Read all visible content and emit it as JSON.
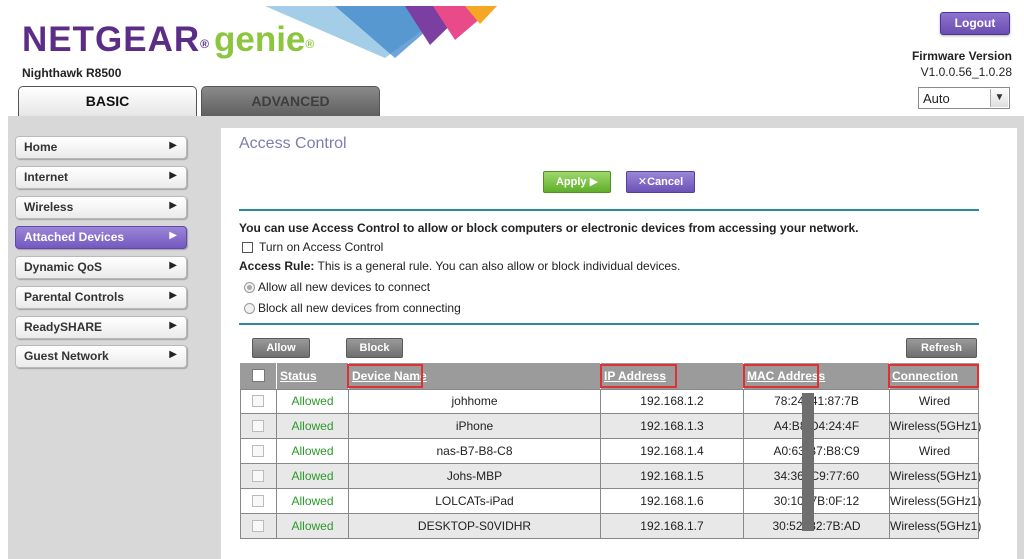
{
  "header": {
    "brand": "NETGEAR",
    "product": "genie",
    "model": "Nighthawk R8500",
    "logout_label": "Logout",
    "firmware_label": "Firmware Version",
    "firmware_version": "V1.0.0.56_1.0.28",
    "language_select": "Auto"
  },
  "tabs": [
    {
      "label": "BASIC",
      "active": true
    },
    {
      "label": "ADVANCED",
      "active": false
    }
  ],
  "sidebar": {
    "items": [
      {
        "label": "Home",
        "active": false
      },
      {
        "label": "Internet",
        "active": false
      },
      {
        "label": "Wireless",
        "active": false
      },
      {
        "label": "Attached Devices",
        "active": true
      },
      {
        "label": "Dynamic QoS",
        "active": false
      },
      {
        "label": "Parental Controls",
        "active": false
      },
      {
        "label": "ReadySHARE",
        "active": false
      },
      {
        "label": "Guest Network",
        "active": false
      }
    ]
  },
  "main": {
    "title": "Access Control",
    "apply_label": "Apply ▶",
    "cancel_label": "Cancel",
    "intro": "You can use Access Control to allow or block computers or electronic devices from accessing your network.",
    "turn_on_label": "Turn on Access Control",
    "turn_on_checked": false,
    "access_rule_bold": "Access Rule:",
    "access_rule_text": " This is a general rule. You can also allow or block individual devices.",
    "radio_allow": "Allow all new devices to connect",
    "radio_block": "Block all new devices from connecting",
    "radio_selected": "allow",
    "allow_button": "Allow",
    "block_button": "Block",
    "refresh_button": "Refresh"
  },
  "table": {
    "columns": [
      "Status",
      "Device Name",
      "IP Address",
      "MAC Address",
      "Connection Type"
    ],
    "rows": [
      {
        "status": "Allowed",
        "device": "johhome",
        "ip": "192.168.1.2",
        "mac": "78:24 :41:87:7B",
        "type": "Wired"
      },
      {
        "status": "Allowed",
        "device": "iPhone",
        "ip": "192.168.1.3",
        "mac": "A4:B8 D4:24:4F",
        "type": "Wireless(5GHz1)"
      },
      {
        "status": "Allowed",
        "device": "nas-B7-B8-C8",
        "ip": "192.168.1.4",
        "mac": "A0:63 B7:B8:C9",
        "type": "Wired"
      },
      {
        "status": "Allowed",
        "device": "Johs-MBP",
        "ip": "192.168.1.5",
        "mac": "34:36 :C9:77:60",
        "type": "Wireless(5GHz1)"
      },
      {
        "status": "Allowed",
        "device": "LOLCATs-iPad",
        "ip": "192.168.1.6",
        "mac": "30:10 :7B:0F:12",
        "type": "Wireless(5GHz1)"
      },
      {
        "status": "Allowed",
        "device": "DESKTOP-S0VIDHR",
        "ip": "192.168.1.7",
        "mac": "30:52 :82:7B:AD",
        "type": "Wireless(5GHz1)"
      }
    ]
  },
  "colors": {
    "brand_purple": "#5b2d86",
    "genie_green": "#8cc63f",
    "accent_teal": "#2b8b9a",
    "allowed_green": "#2a9a2a",
    "highlight_red": "#e03030"
  }
}
